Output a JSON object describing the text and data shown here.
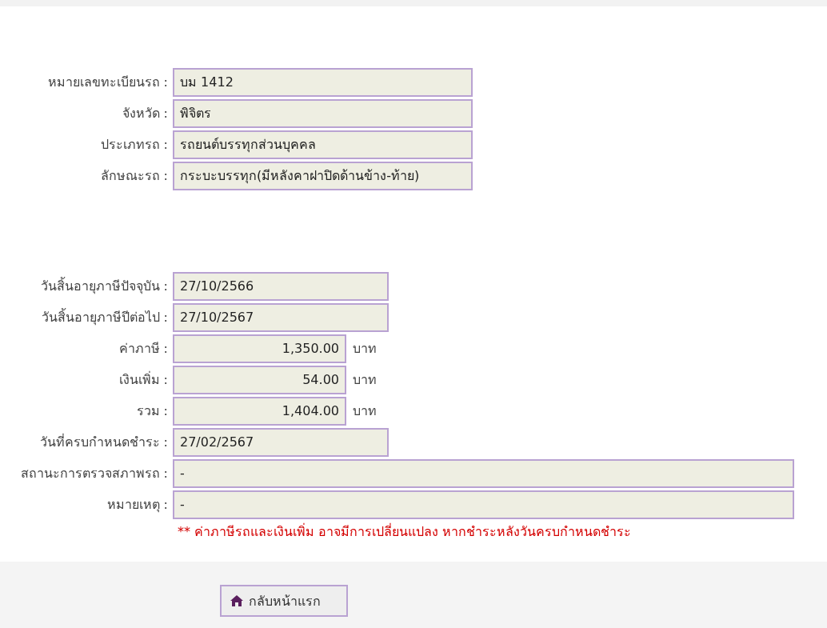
{
  "vehicle": [
    {
      "label": "หมายเลขทะเบียนรถ :",
      "value": "บม 1412",
      "kind": "medium"
    },
    {
      "label": "จังหวัด :",
      "value": "พิจิตร",
      "kind": "medium"
    },
    {
      "label": "ประเภทรถ :",
      "value": "รถยนต์บรรทุกส่วนบุคคล",
      "kind": "medium"
    },
    {
      "label": "ลักษณะรถ :",
      "value": "กระบะบรรทุก(มีหลังคาฝาปิดด้านข้าง-ท้าย)",
      "kind": "medium"
    }
  ],
  "tax": [
    {
      "label": "วันสิ้นอายุภาษีปัจจุบัน :",
      "value": "27/10/2566",
      "kind": "short"
    },
    {
      "label": "วันสิ้นอายุภาษีปีต่อไป :",
      "value": "27/10/2567",
      "kind": "short"
    },
    {
      "label": "ค่าภาษี :",
      "value": "1,350.00",
      "kind": "amount",
      "unit": "บาท"
    },
    {
      "label": "เงินเพิ่ม :",
      "value": "54.00",
      "kind": "amount",
      "unit": "บาท"
    },
    {
      "label": "รวม :",
      "value": "1,404.00",
      "kind": "amount",
      "unit": "บาท"
    },
    {
      "label": "วันที่ครบกำหนดชำระ :",
      "value": "27/02/2567",
      "kind": "short"
    },
    {
      "label": "สถานะการตรวจสภาพรถ :",
      "value": "-",
      "kind": "full"
    },
    {
      "label": "หมายเหตุ :",
      "value": "-",
      "kind": "full"
    }
  ],
  "note": "** ค่าภาษีรถและเงินเพิ่ม อาจมีการเปลี่ยนแปลง หากชำระหลังวันครบกำหนดชำระ",
  "home_button": "กลับหน้าแรก"
}
